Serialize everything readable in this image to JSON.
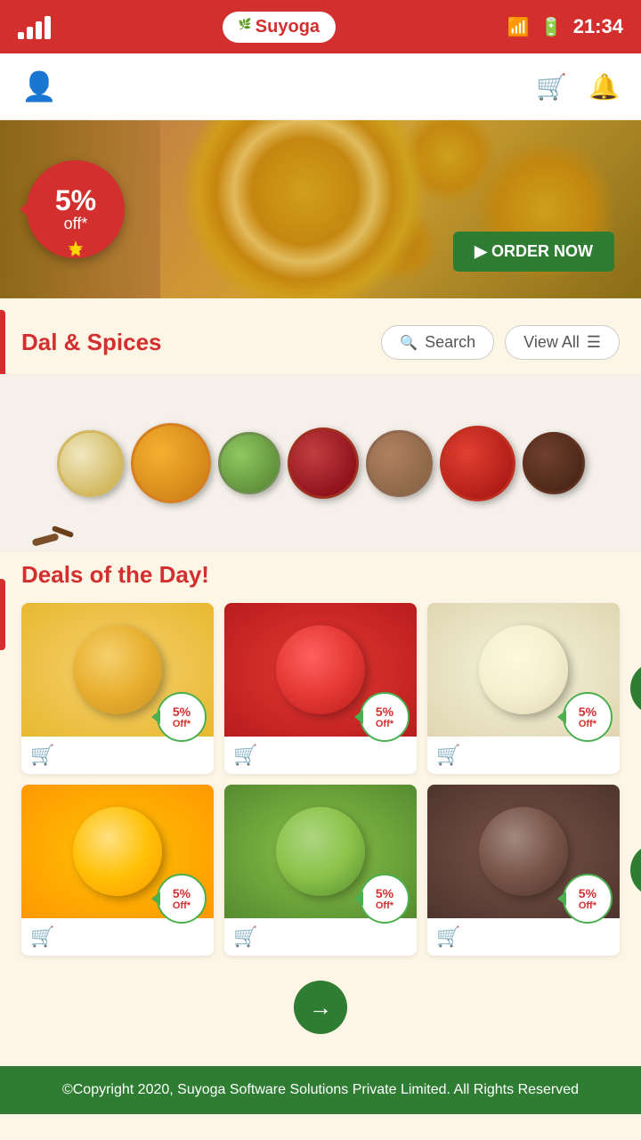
{
  "statusBar": {
    "time": "21:34"
  },
  "header": {
    "logo": "Suyoga",
    "cartIcon": "🛒",
    "bellIcon": "🔔",
    "userIcon": "👤"
  },
  "banner": {
    "discountPercent": "5%",
    "discountOff": "off*",
    "orderNowLabel": "▶ ORDER NOW"
  },
  "dalSpices": {
    "title": "Dal & Spices",
    "searchPlaceholder": "Search",
    "viewAllLabel": "View All"
  },
  "dealsSection": {
    "title": "Deals of the Day!",
    "products": [
      {
        "id": 1,
        "badge": "5%",
        "badgeOff": "Off*",
        "bgColor": "#f5d06e"
      },
      {
        "id": 2,
        "badge": "5%",
        "badgeOff": "Off*",
        "bgColor": "#e53935"
      },
      {
        "id": 3,
        "badge": "5%",
        "badgeOff": "Off*",
        "bgColor": "#f5f5dc"
      },
      {
        "id": 4,
        "badge": "5%",
        "badgeOff": "Off*",
        "bgColor": "#ffc107"
      },
      {
        "id": 5,
        "badge": "5%",
        "badgeOff": "Off*",
        "bgColor": "#8bc34a"
      },
      {
        "id": 6,
        "badge": "5%",
        "badgeOff": "Off*",
        "bgColor": "#795548"
      }
    ]
  },
  "footer": {
    "text": "©Copyright 2020, Suyoga Software Solutions Private Limited. All Rights Reserved"
  },
  "colors": {
    "primaryRed": "#d32f2f",
    "primaryGreen": "#2e7d32",
    "lightGreen": "#4caf50",
    "bgBeige": "#fdf5e6"
  }
}
